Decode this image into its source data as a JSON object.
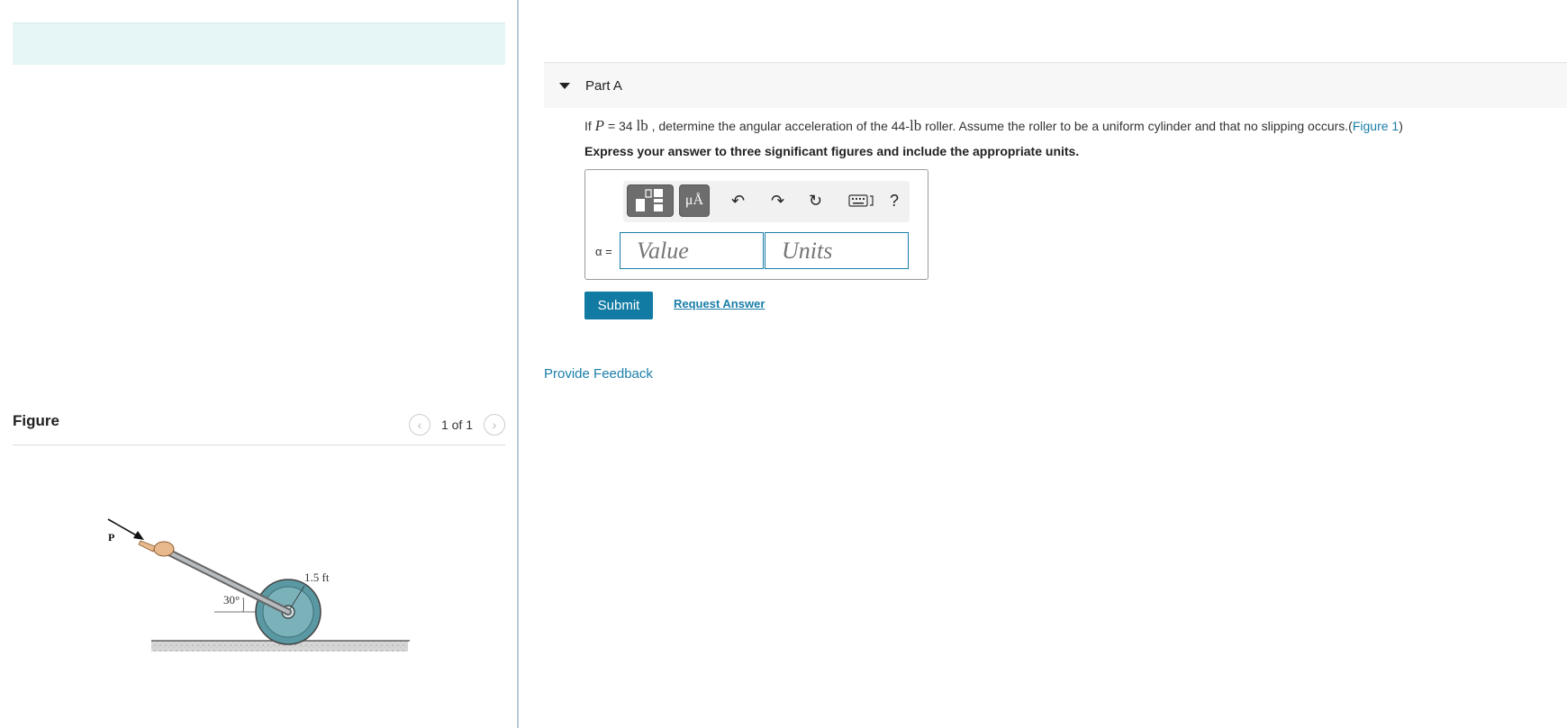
{
  "figure_panel": {
    "title": "Figure",
    "pager_text": "1 of 1",
    "labels": {
      "force": "P",
      "angle": "30°",
      "radius": "1.5 ft"
    }
  },
  "part": {
    "title": "Part A",
    "question": {
      "t1": "If ",
      "var": "P",
      "t2": " = 34 ",
      "unit1": "lb",
      "t3": " , determine the angular acceleration of the 44-",
      "unit2": "lb",
      "t4": " roller. Assume the roller to be a uniform cylinder and that no slipping occurs.(",
      "figure_link": "Figure 1",
      "t5": ")"
    },
    "instruction": "Express your answer to three significant figures and include the appropriate units.",
    "toolbar": {
      "units_label": "μÅ",
      "help": "?"
    },
    "variable_label": "α =",
    "value_placeholder": "Value",
    "units_placeholder": "Units",
    "submit_label": "Submit",
    "request_answer_label": "Request Answer"
  },
  "feedback_label": "Provide Feedback",
  "colors": {
    "accent": "#117ba3",
    "link": "#1a7ea8",
    "banner": "#e6f6f6"
  }
}
